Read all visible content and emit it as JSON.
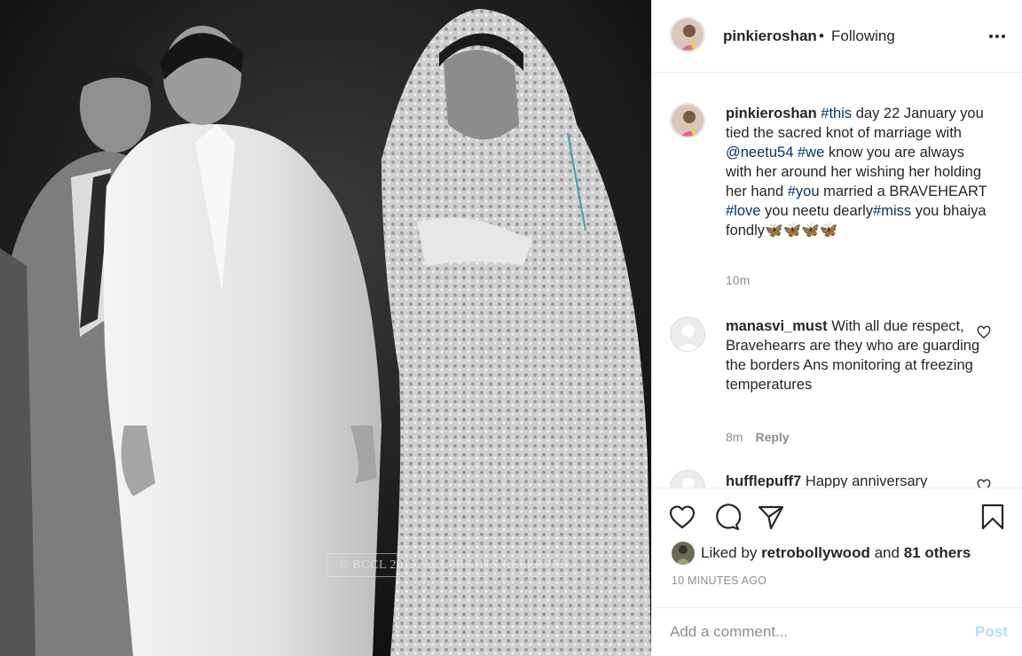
{
  "post": {
    "author": "pinkieroshan",
    "follow_dot": "•",
    "follow_status": "Following",
    "photo_watermark": "© BCCL 2013. ALL RIGHTS RESERVED."
  },
  "caption": {
    "user": "pinkieroshan",
    "segments": [
      {
        "text": "#this",
        "tag": true
      },
      {
        "text": " day 22 January you tied the sacred knot of marriage with ",
        "tag": false
      },
      {
        "text": "@neetu54",
        "tag": true
      },
      {
        "text": " ",
        "tag": false
      },
      {
        "text": "#we",
        "tag": true
      },
      {
        "text": " know you are always with her around her wishing her holding her hand ",
        "tag": false
      },
      {
        "text": "#you",
        "tag": true
      },
      {
        "text": " married a BRAVEHEART ",
        "tag": false
      },
      {
        "text": "#love",
        "tag": true
      },
      {
        "text": " you neetu dearly",
        "tag": false
      },
      {
        "text": "#miss",
        "tag": true
      },
      {
        "text": " you bhaiya fondly🦋🦋🦋🦋",
        "tag": false
      }
    ],
    "time": "10m"
  },
  "comments": [
    {
      "user": "manasvi_must",
      "text": "With all due respect, Bravehearrs are they who are guarding the borders Ans monitoring at freezing temperatures",
      "time": "8m",
      "reply_label": "Reply"
    },
    {
      "user": "hufflepuff7",
      "text": "Happy anniversary"
    }
  ],
  "likes": {
    "prefix": "Liked by",
    "user": "retrobollywood",
    "joiner": "and",
    "others": "81 others"
  },
  "time_ago": "10 MINUTES AGO",
  "comment_box": {
    "placeholder": "Add a comment...",
    "post_label": "Post"
  },
  "icons": {
    "more": "more-icon",
    "like": "heart-icon",
    "comment": "comment-icon",
    "share": "share-icon",
    "save": "bookmark-icon"
  },
  "colors": {
    "hashtag": "#00376b",
    "post_button_disabled": "#b2dffc",
    "muted": "#8e8e8e"
  }
}
